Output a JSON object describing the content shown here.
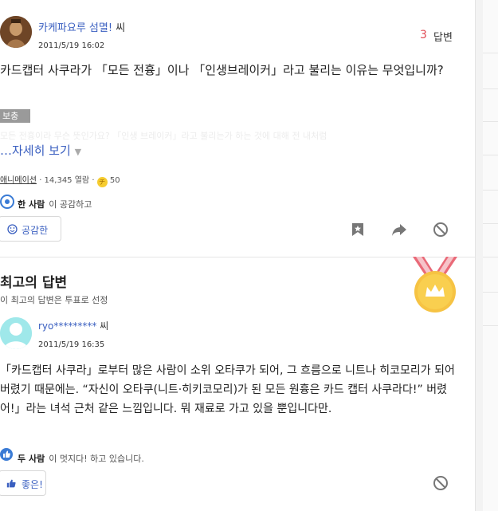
{
  "question": {
    "user_name": "카케파요루 섬멸!",
    "user_suffix": "씨",
    "date": "2011/5/19 16:02",
    "answer_count": "3",
    "answer_label": "답변",
    "text": "카드캡터 사쿠라가 「모든 전흉」이나 「인생브레이커」라고 불리는 이유는 무엇입니까?",
    "supplement_label": "보충",
    "supplement_preview": "모든 전흉이라 무슨 뜻인가요? 「인생 브레이커」라고 불리는가 하는 것에 대해 전 내처럼",
    "more_label": "…자세히 보기",
    "more_icon": "caret-down",
    "category": "애니메이션",
    "views": "14,345 열람",
    "coin_label": "チ",
    "coins": "50",
    "empathy_count": "한 사람",
    "empathy_text": "이 공감하고",
    "empathy_button": "공감한"
  },
  "best": {
    "heading": "최고의 답변",
    "subtext": "이 최고의 답변은 투표로 선정",
    "user_name": "ryo*********",
    "user_suffix": "씨",
    "date": "2011/5/19 16:35",
    "text": "「카드캡터 사쿠라」로부터 많은 사람이 소위 오타쿠가 되어, 그 흐름으로 니트나 히코모리가 되어 버렸기 때문에는. “자신이 오타쿠(니트·히키코모리)가 된 모든 원흉은 카드 캡터 사쿠라다!” 버렸어!」라는 녀석 근처 같은 느낌입니다. 뭐 재료로 가고 있을 뿐입니다만.",
    "like_count": "두 사람",
    "like_text": "이 멋지다! 하고 있습니다.",
    "like_button": "좋은!"
  },
  "colors": {
    "link": "#3a5fc0",
    "accent_red": "#e04b55",
    "gold": "#f6c343"
  }
}
